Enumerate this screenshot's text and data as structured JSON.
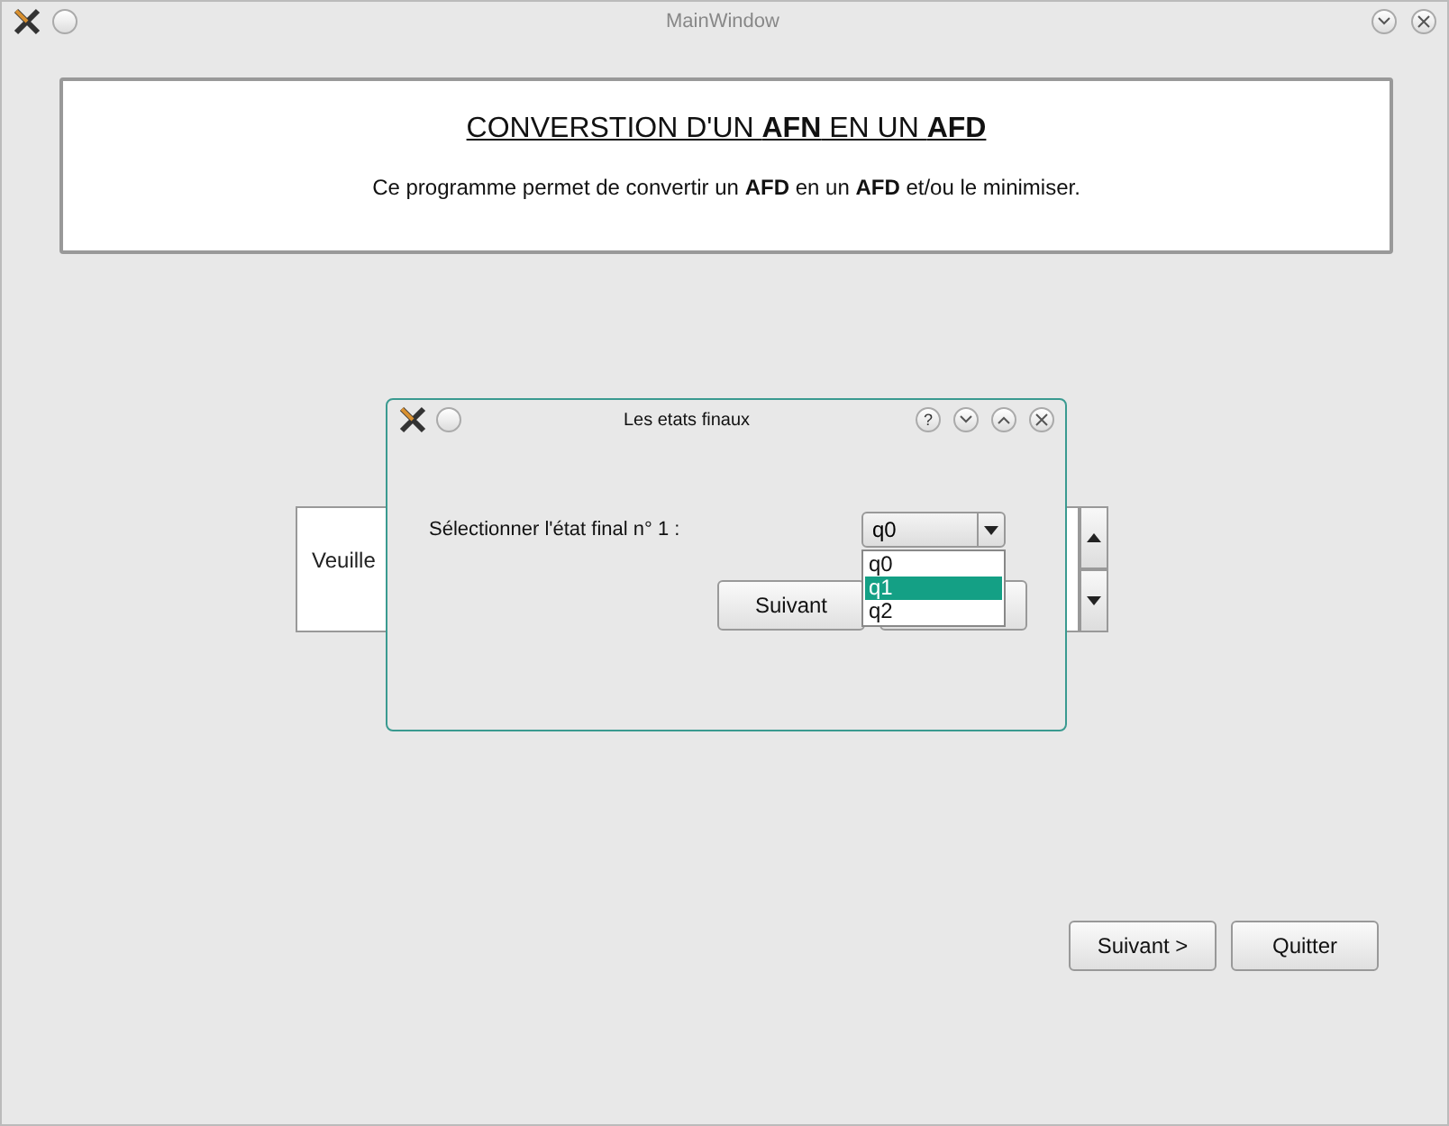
{
  "window": {
    "title": "MainWindow"
  },
  "header": {
    "title": "CONVERSTION D'UN **AFN** EN UN **AFD**",
    "description": "Ce programme permet de convertir un **AFD** en un **AFD** et/ou le minimiser."
  },
  "input_panel": {
    "text": "Veuille"
  },
  "dialog": {
    "title": "Les etats finaux",
    "help_button": "?",
    "label": "Sélectionner l'état final n° 1 :",
    "combo": {
      "value": "q0",
      "options": [
        {
          "label": "q0",
          "highlighted": false
        },
        {
          "label": "q1",
          "highlighted": true
        },
        {
          "label": "q2",
          "highlighted": false
        }
      ]
    },
    "buttons": [
      "Suivant"
    ]
  },
  "buttons": [
    "Suivant >",
    "Quitter"
  ]
}
